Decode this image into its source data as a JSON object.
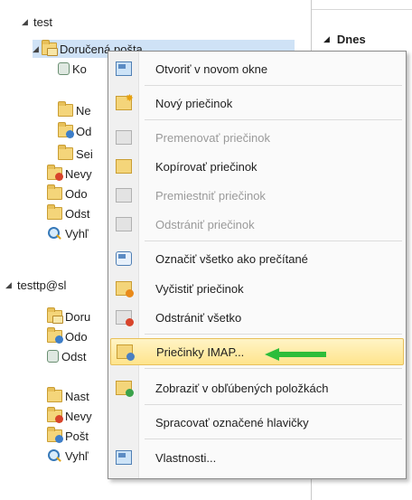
{
  "tree": {
    "account1": "test",
    "inbox1": "Doručená pošta",
    "inbox1_child": "Ko",
    "ne": "Ne",
    "od": "Od",
    "se": "Sei",
    "nevy": "Nevy",
    "odo": "Odo",
    "odst": "Odst",
    "vyhl": "Vyhľ",
    "account2": "testtp@sl",
    "inbox2": "Doru",
    "odo2": "Odo",
    "odst2": "Odst",
    "nast": "Nast",
    "nevy2": "Nevy",
    "post": "Pošt",
    "vyhl2": "Vyhľ"
  },
  "right_pane": {
    "group_label": "Dnes"
  },
  "menu": {
    "items": [
      {
        "label": "Otvoriť v novom okne",
        "icon": "new-window-icon",
        "disabled": false
      },
      {
        "label": "Nový priečinok",
        "icon": "new-folder-icon",
        "disabled": false
      },
      {
        "label": "Premenovať priečinok",
        "icon": "rename-folder-icon",
        "disabled": true
      },
      {
        "label": "Kopírovať priečinok",
        "icon": "copy-folder-icon",
        "disabled": false
      },
      {
        "label": "Premiestniť priečinok",
        "icon": "move-folder-icon",
        "disabled": true
      },
      {
        "label": "Odstrániť priečinok",
        "icon": "delete-folder-icon",
        "disabled": true
      },
      {
        "label": "Označiť všetko ako prečítané",
        "icon": "mark-read-icon",
        "disabled": false
      },
      {
        "label": "Vyčistiť priečinok",
        "icon": "clean-folder-icon",
        "disabled": false
      },
      {
        "label": "Odstrániť všetko",
        "icon": "delete-all-icon",
        "disabled": false
      },
      {
        "label": "Priečinky IMAP...",
        "icon": "imap-folders-icon",
        "disabled": false,
        "highlighted": true
      },
      {
        "label": "Zobraziť v obľúbených položkách",
        "icon": "favorites-icon",
        "disabled": false
      },
      {
        "label": "Spracovať označené hlavičky",
        "icon": "process-headers-icon",
        "disabled": false
      },
      {
        "label": "Vlastnosti...",
        "icon": "properties-icon",
        "disabled": false
      }
    ]
  },
  "colors": {
    "highlight": "#ffe48c",
    "arrow": "#2dbd3a",
    "selection": "#cfe2f6"
  }
}
